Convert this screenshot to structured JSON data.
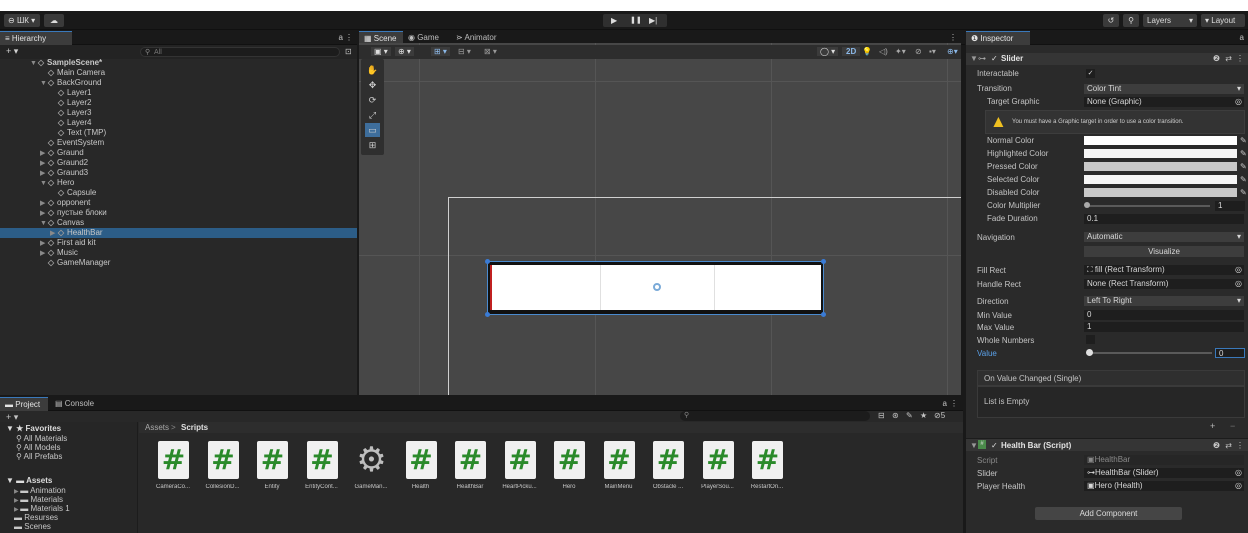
{
  "toolbar": {
    "account": "ШК ▾",
    "cloud": "☁",
    "play": "▶",
    "pause": "❚❚",
    "step": "▶|",
    "history": "↺",
    "search": "⚲",
    "layers": "Layers",
    "layout": "Layout"
  },
  "hierarchy": {
    "tab": "Hierarchy",
    "search_placeholder": "All",
    "add": "+ ▾",
    "items": [
      {
        "label": "SampleScene*",
        "depth": 0,
        "arrow": "▼"
      },
      {
        "label": "Main Camera",
        "depth": 1,
        "arrow": ""
      },
      {
        "label": "BackGround",
        "depth": 1,
        "arrow": "▼"
      },
      {
        "label": "Layer1",
        "depth": 2,
        "arrow": ""
      },
      {
        "label": "Layer2",
        "depth": 2,
        "arrow": ""
      },
      {
        "label": "Layer3",
        "depth": 2,
        "arrow": ""
      },
      {
        "label": "Layer4",
        "depth": 2,
        "arrow": ""
      },
      {
        "label": "Text (TMP)",
        "depth": 2,
        "arrow": ""
      },
      {
        "label": "EventSystem",
        "depth": 1,
        "arrow": ""
      },
      {
        "label": "Graund",
        "depth": 1,
        "arrow": "▶"
      },
      {
        "label": "Graund2",
        "depth": 1,
        "arrow": "▶"
      },
      {
        "label": "Graund3",
        "depth": 1,
        "arrow": "▶"
      },
      {
        "label": "Hero",
        "depth": 1,
        "arrow": "▼"
      },
      {
        "label": "Capsule",
        "depth": 2,
        "arrow": ""
      },
      {
        "label": "opponent",
        "depth": 1,
        "arrow": "▶"
      },
      {
        "label": "пустые блоки",
        "depth": 1,
        "arrow": "▶"
      },
      {
        "label": "Canvas",
        "depth": 1,
        "arrow": "▼"
      },
      {
        "label": "HealthBar",
        "depth": 2,
        "arrow": "▶",
        "selected": true
      },
      {
        "label": "First aid kit",
        "depth": 1,
        "arrow": "▶"
      },
      {
        "label": "Music",
        "depth": 1,
        "arrow": "▶"
      },
      {
        "label": "GameManager",
        "depth": 1,
        "arrow": ""
      }
    ]
  },
  "scene": {
    "tabs": [
      "Scene",
      "Game",
      "Animator"
    ],
    "mode_2d": "2D",
    "tools": [
      "✋",
      "✥",
      "⟳",
      "⤢",
      "▭",
      "⊞"
    ]
  },
  "project": {
    "tabs": [
      "Project",
      "Console"
    ],
    "add": "+ ▾",
    "breadcrumb_root": "Assets",
    "breadcrumb_sep": ">",
    "breadcrumb_leaf": "Scripts",
    "hidden_count": "5",
    "favorites_title": "Favorites",
    "favorites": [
      "All Materials",
      "All Models",
      "All Prefabs"
    ],
    "assets_title": "Assets",
    "asset_folders": [
      "Animation",
      "Materials",
      "Materials 1",
      "Resurses",
      "Scenes"
    ],
    "scripts": [
      "CameraCo...",
      "CollesionD...",
      "Entity",
      "EntityCont...",
      "GameMan...",
      "Health",
      "HealthBar",
      "HeartPicku...",
      "Hero",
      "MainMenu",
      "Obstacle ...",
      "PlayerSou...",
      "RestartOn..."
    ]
  },
  "inspector": {
    "tab": "Inspector",
    "slider_title": "Slider",
    "interactable_label": "Interactable",
    "transition_label": "Transition",
    "transition_value": "Color Tint",
    "target_graphic_label": "Target Graphic",
    "target_graphic_value": "None (Graphic)",
    "warning": "You must have a Graphic target in order to use a color transition.",
    "colors": [
      {
        "label": "Normal Color",
        "hex": "#ffffff"
      },
      {
        "label": "Highlighted Color",
        "hex": "#f5f5f5"
      },
      {
        "label": "Pressed Color",
        "hex": "#c8c8c8"
      },
      {
        "label": "Selected Color",
        "hex": "#f5f5f5"
      },
      {
        "label": "Disabled Color",
        "hex": "#c8c8c8"
      }
    ],
    "color_multiplier_label": "Color Multiplier",
    "color_multiplier_value": "1",
    "fade_duration_label": "Fade Duration",
    "fade_duration_value": "0.1",
    "navigation_label": "Navigation",
    "navigation_value": "Automatic",
    "visualize_label": "Visualize",
    "fill_rect_label": "Fill Rect",
    "fill_rect_value": "fill (Rect Transform)",
    "handle_rect_label": "Handle Rect",
    "handle_rect_value": "None (Rect Transform)",
    "direction_label": "Direction",
    "direction_value": "Left To Right",
    "min_value_label": "Min Value",
    "min_value": "0",
    "max_value_label": "Max Value",
    "max_value": "1",
    "whole_numbers_label": "Whole Numbers",
    "value_label": "Value",
    "value": "0",
    "on_value_changed": "On Value Changed (Single)",
    "list_empty": "List is Empty",
    "healthbar_title": "Health Bar (Script)",
    "script_label": "Script",
    "script_value": "HealthBar",
    "slider_label": "Slider",
    "slider_value": "HealthBar (Slider)",
    "player_health_label": "Player Health",
    "player_health_value": "Hero (Health)",
    "add_component": "Add Component"
  }
}
